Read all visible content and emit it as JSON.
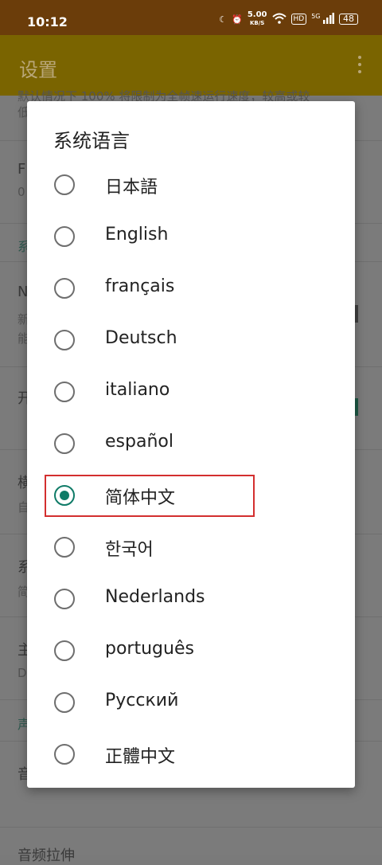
{
  "status_bar": {
    "time": "10:12",
    "network_speed": "5.00",
    "network_speed_unit": "KB/S",
    "hd_label": "HD",
    "signal_label": "5G",
    "battery": "48"
  },
  "app_bar": {
    "title": "设置"
  },
  "background": {
    "line1": "默认情况下 100% 将限制为全帧速运行速度，较高或较",
    "line2": "低",
    "items": [
      {
        "title": "F",
        "sub": "0"
      },
      {
        "header": "系"
      },
      {
        "title": "N",
        "sub": "新",
        "sub2": "能"
      },
      {
        "title": "开"
      },
      {
        "title": "横",
        "sub": "自"
      },
      {
        "title": "系",
        "sub": "简"
      },
      {
        "title": "主",
        "sub": "D"
      },
      {
        "header": "声"
      },
      {
        "title": "音"
      },
      {
        "title": "音频拉伸"
      }
    ]
  },
  "dialog": {
    "title": "系统语言",
    "selected_index": 6,
    "options": [
      "日本語",
      "English",
      "français",
      "Deutsch",
      "italiano",
      "español",
      "简体中文",
      "한국어",
      "Nederlands",
      "português",
      "Русский",
      "正體中文"
    ]
  },
  "colors": {
    "accent": "#0f7b67",
    "highlight_box": "#d32f2f"
  }
}
